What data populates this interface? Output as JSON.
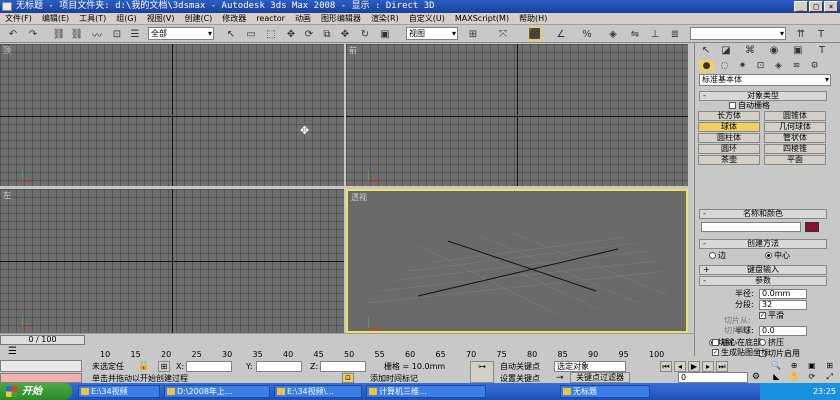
{
  "window": {
    "title": "无标题   - 项目文件夹: d:\\我的文档\\3dsmax    - Autodesk 3ds Max 2008    - 显示 : Direct 3D"
  },
  "menu": [
    "文件(F)",
    "编辑(E)",
    "工具(T)",
    "组(G)",
    "视图(V)",
    "创建(C)",
    "修改器",
    "reactor",
    "动画",
    "图形编辑器",
    "渲染(R)",
    "自定义(U)",
    "MAXScript(M)",
    "帮助(H)"
  ],
  "toolbar": {
    "selection_filter": "全部",
    "reference_coord": "视图"
  },
  "viewports": {
    "top": "顶",
    "front": "前",
    "left": "左",
    "perspective": "透视"
  },
  "command_panel": {
    "category": "标准基本体",
    "object_type": {
      "title": "对象类型",
      "autogrid": "自动栅格",
      "buttons": [
        "长方体",
        "圆锥体",
        "球体",
        "几何球体",
        "圆柱体",
        "管状体",
        "圆环",
        "四棱锥",
        "茶壶",
        "平面"
      ]
    },
    "name_color_title": "名称和颜色",
    "name_value": "",
    "creation_method": {
      "title": "创建方法",
      "edge": "边",
      "center": "中心"
    },
    "keyboard_entry": "键盘输入",
    "parameters": {
      "title": "参数",
      "radius_label": "半径:",
      "radius_value": "0.0mm",
      "segments_label": "分段:",
      "segments_value": "32",
      "smooth": "平滑",
      "hemisphere_label": "半球:",
      "hemisphere_value": "0.0",
      "chop": "切除",
      "squash": "挤压",
      "slice_on": "切片启用",
      "slice_from": "切片从:",
      "slice_to": "切片到:",
      "base_to_pivot": "轴心在底部",
      "gen_uv": "生成贴图坐标"
    }
  },
  "timeline": {
    "slider": "0 / 100",
    "ticks": [
      "10",
      "15",
      "20",
      "25",
      "30",
      "35",
      "40",
      "45",
      "50",
      "55",
      "60",
      "65",
      "70",
      "75",
      "80",
      "85",
      "90",
      "95",
      "100"
    ]
  },
  "status": {
    "selection": "未选定任",
    "x_label": "X:",
    "y_label": "Y:",
    "z_label": "Z:",
    "grid": "栅格 = 10.0mm",
    "prompt": "单击并拖动以开始创建过程",
    "add_time_tag": "添加时间标记",
    "auto_key": "自动关键点",
    "set_key": "设置关键点",
    "selected_object": "选定对象",
    "key_filters": "关键点过滤器",
    "frame": "0"
  },
  "taskbar": {
    "start": "开始",
    "tasks": [
      "E:\\34视频",
      "D:\\2008年上...",
      "E:\\34视频\\...",
      "计算机三维...",
      "无标题"
    ],
    "clock": "23:25"
  }
}
